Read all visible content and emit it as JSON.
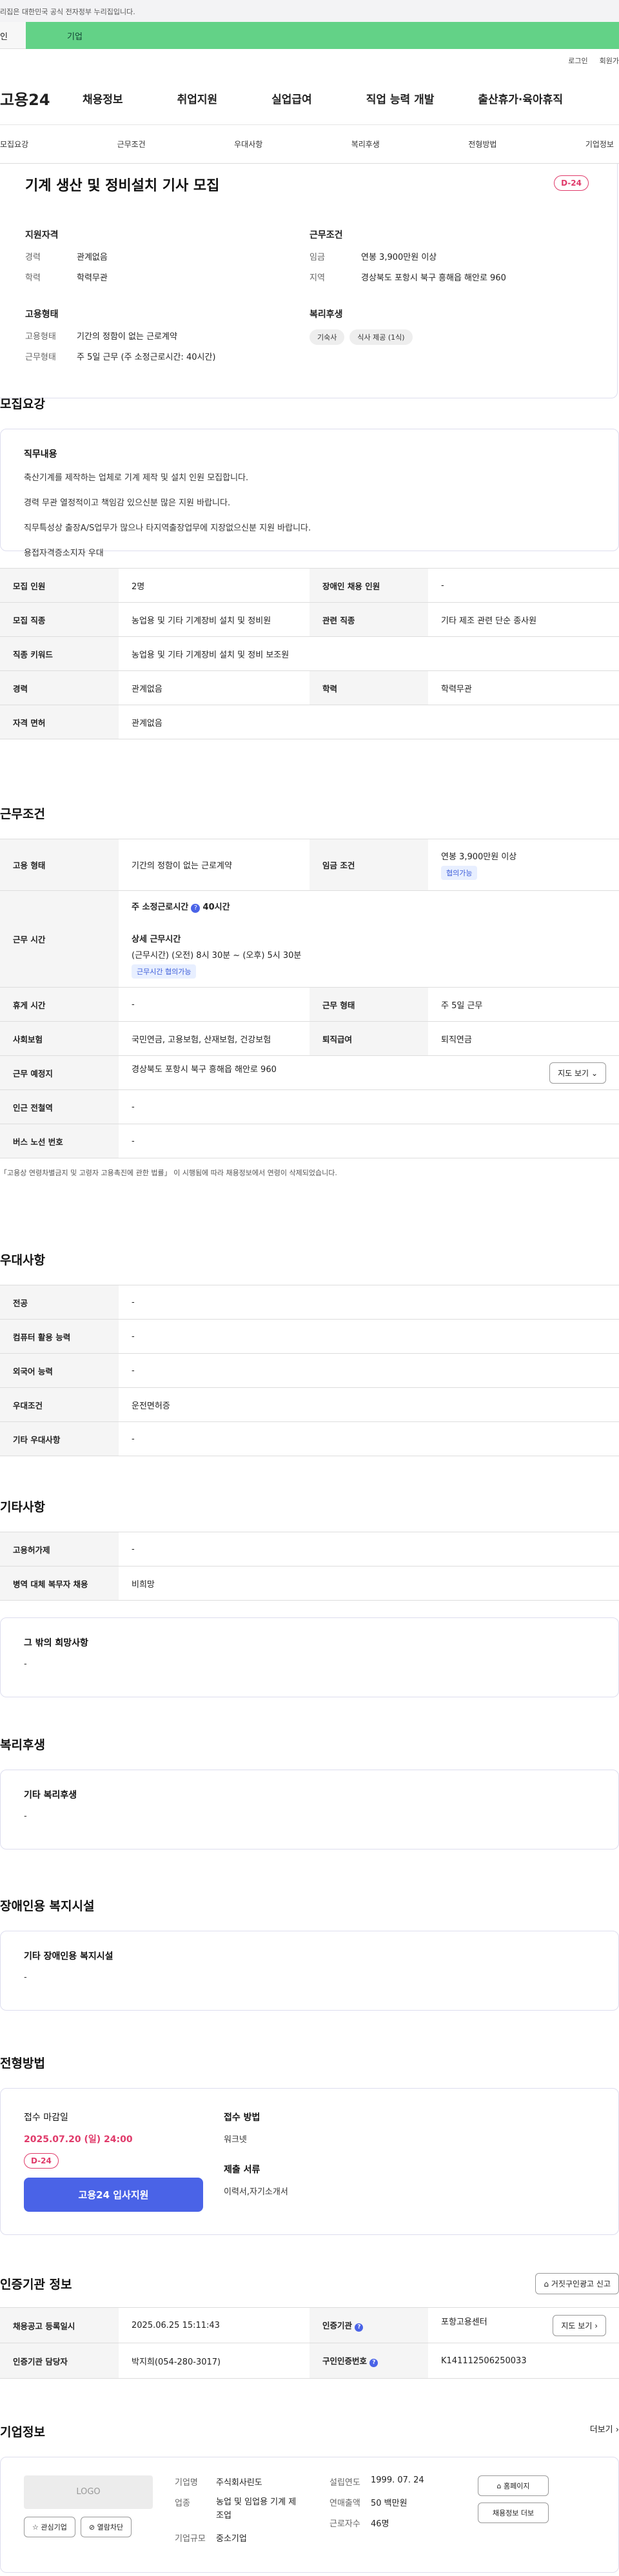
{
  "banner": {
    "text": "리집은 대한민국 공식 전자정부 누리집입니다."
  },
  "tabs": {
    "t1": "인",
    "t2": "기업"
  },
  "util": {
    "login": "로그인",
    "join": "회원가"
  },
  "gnb": {
    "logo": "고용24",
    "items": [
      "채용정보",
      "취업지원",
      "실업급여",
      "직업 능력 개발",
      "출산휴가·육아휴직"
    ]
  },
  "anchor": [
    "모집요강",
    "근무조건",
    "우대사항",
    "복리후생",
    "전형방법",
    "기업정보"
  ],
  "summary": {
    "title": "기계 생산 및 정비설치 기사 모집",
    "dday": "D-24",
    "qual_h": "지원자격",
    "career_k": "경력",
    "career_v": "관계없음",
    "edu_k": "학력",
    "edu_v": "학력무관",
    "work_h": "근무조건",
    "wage_k": "임금",
    "wage_v": "연봉 3,900만원 이상",
    "loc_k": "지역",
    "loc_v": "경상북도 포항시 북구 흥해읍 해안로 960",
    "emp_h": "고용형태",
    "emptype_k": "고용형태",
    "emptype_v": "기간의 정함이 없는 근로계약",
    "hours_k": "근무형태",
    "hours_v": "주 5일 근무 (주 소정근로시간: 40시간)",
    "welfare_h": "복리후생",
    "chips": [
      "기숙사",
      "식사 제공 (1식)"
    ]
  },
  "recruit": {
    "title": "모집요강",
    "duty_h": "직무내용",
    "lines": [
      "축산기계를 제작하는 업체로 기계 제작 및 설치 인원 모집합니다.",
      "경력 무관 열정적이고 책임감 있으신분 많은 지원 바랍니다.",
      "직무특성상 출장A/S업무가 많으나 타지역출장업무에 지장없으신분 지원 바랍니다.",
      "용접자격증소지자 우대"
    ],
    "rows": [
      [
        "모집 인원",
        "2명",
        "장애인 채용 인원",
        "-"
      ],
      [
        "모집 직종",
        "농업용 및 기타 기계장비 설치 및 정비원",
        "관련 직종",
        "기타 제조 관련 단순 종사원"
      ],
      [
        "직종 키워드",
        "농업용 및 기타 기계장비 설치 및 정비 보조원"
      ],
      [
        "경력",
        "관계없음",
        "학력",
        "학력무관"
      ],
      [
        "자격 면허",
        "관계없음"
      ]
    ]
  },
  "work": {
    "title": "근무조건",
    "emp_k": "고용 형태",
    "emp_v": "기간의 정함이 없는 근로계약",
    "wage_k": "임금 조건",
    "wage_v": "연봉 3,900만원 이상",
    "wage_tag": "협의가능",
    "time_k": "근무 시간",
    "time_v1": "주 소정근로시간",
    "time_v2": "40시간",
    "time_d_h": "상세 근무시간",
    "time_d_v": "(근무시간) (오전) 8시 30분 ~ (오후) 5시 30분",
    "time_tag": "근무시간 협의가능",
    "break_k": "휴게 시간",
    "break_v": "-",
    "type_k": "근무 형태",
    "type_v": "주 5일 근무",
    "ins_k": "사회보험",
    "ins_v": "국민연금, 고용보험, 산재보험, 건강보험",
    "ret_k": "퇴직급여",
    "ret_v": "퇴직연금",
    "place_k": "근무 예정지",
    "place_v": "경상북도 포항시 북구 흥해읍 해안로 960",
    "map_btn": "지도 보기",
    "subway_k": "인근 전철역",
    "subway_v": "-",
    "bus_k": "버스 노선 번호",
    "bus_v": "-",
    "note": "「고용상 연령차별금지 및 고령자 고용촉진에 관한 법률」 이 시행됨에 따라 채용정보에서 연령이 삭제되었습니다."
  },
  "pref": {
    "title": "우대사항",
    "rows": [
      [
        "전공",
        "-"
      ],
      [
        "컴퓨터 활용 능력",
        "-"
      ],
      [
        "외국어 능력",
        "-"
      ],
      [
        "우대조건",
        "운전면허증"
      ],
      [
        "기타 우대사항",
        "-"
      ]
    ]
  },
  "etc": {
    "title": "기타사항",
    "rows": [
      [
        "고용허가제",
        "-"
      ],
      [
        "병역 대체 복무자 채용",
        "비희망"
      ]
    ],
    "wish_h": "그 밖의 희망사항",
    "wish_v": "-"
  },
  "welfare": {
    "title": "복리후생",
    "h": "기타 복리후생",
    "v": "-"
  },
  "disab": {
    "title": "장애인용 복지시설",
    "h": "기타 장애인용 복지시설",
    "v": "-"
  },
  "select": {
    "title": "전형방법",
    "deadline_h": "접수 마감일",
    "deadline_v": "2025.07.20 (일) 24:00",
    "dday": "D-24",
    "apply_btn": "고용24 입사지원",
    "method_h": "접수 방법",
    "method_v": "워크넷",
    "docs_h": "제출 서류",
    "docs_v": "이력서,자기소개서"
  },
  "cert": {
    "title": "인증기관 정보",
    "report_btn": "거짓구인광고 신고",
    "rows": [
      [
        "채용공고 등록일시",
        "2025.06.25 15:11:43",
        "인증기관",
        "포항고용센터"
      ],
      [
        "인증기관 담당자",
        "박지희(054-280-3017)",
        "구인인증번호",
        "K141112506250033"
      ]
    ],
    "map_btn": "지도 보기"
  },
  "company": {
    "title": "기업정보",
    "more": "더보기",
    "logo": "LOGO",
    "fav": "관심기업",
    "block": "열람차단",
    "name_k": "기업명",
    "name_v": "주식회사린도",
    "ind_k": "업종",
    "ind_v": "농업 및 임업용 기계 제조업",
    "size_k": "기업규모",
    "size_v": "중소기업",
    "est_k": "설립연도",
    "est_v": "1999. 07. 24",
    "sales_k": "연매출액",
    "sales_v": "50 백만원",
    "emp_k": "근로자수",
    "emp_v": "46명",
    "home_btn": "홈페이지",
    "jobs_btn": "채용정보 더보"
  }
}
